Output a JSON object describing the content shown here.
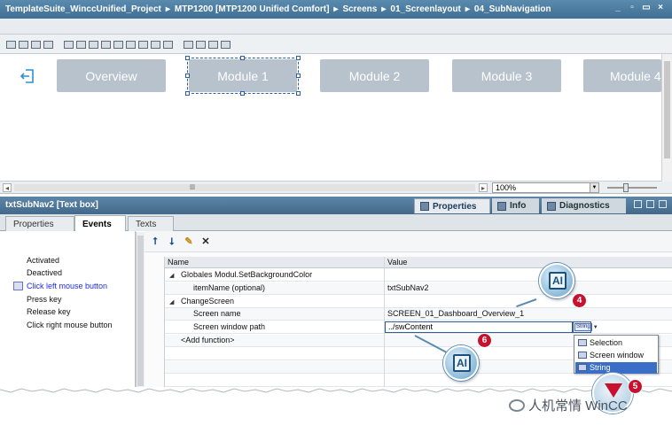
{
  "breadcrumb": {
    "items": [
      "TemplateSuite_WinccUnified_Project",
      "MTP1200 [MTP1200 Unified Comfort]",
      "Screens",
      "01_Screenlayout",
      "04_SubNavigation"
    ],
    "separator": "▸"
  },
  "window_controls": [
    "minimize-icon",
    "restore-icon",
    "maximize-icon",
    "close-icon"
  ],
  "nav": {
    "exit_icon": "logout-icon",
    "buttons": [
      "Overview",
      "Module 1",
      "Module 2",
      "Module 3",
      "Module 4"
    ],
    "selected": "Module 1",
    "button_color": "#b7c2cc"
  },
  "zoom": {
    "value": "100%"
  },
  "properties_panel": {
    "title": "txtSubNav2 [Text box]",
    "tabs": [
      "Properties",
      "Info",
      "Diagnostics"
    ],
    "active_tab": "Properties",
    "subtabs": [
      "Properties",
      "Events",
      "Texts"
    ],
    "active_subtab": "Events"
  },
  "events": {
    "items": [
      "Activated",
      "Deactived",
      "Click left mouse button",
      "Press key",
      "Release key",
      "Click right mouse button"
    ],
    "active": "Click left mouse button"
  },
  "editor": {
    "toolbar": [
      "move-up-icon",
      "move-down-icon",
      "script-icon",
      "delete-icon"
    ],
    "columns": [
      "Name",
      "Value"
    ],
    "rows": [
      {
        "name": "Globales Modul.SetBackgroundColor",
        "value": "",
        "level": 0,
        "expanded": true
      },
      {
        "name": "itemName (optional)",
        "value": "txtSubNav2",
        "level": 1
      },
      {
        "name": "ChangeScreen",
        "value": "",
        "level": 0,
        "expanded": true
      },
      {
        "name": "Screen name",
        "value": "SCREEN_01_Dashboard_Overview_1",
        "level": 1
      },
      {
        "name": "Screen window path",
        "value": "../swContent",
        "level": 1
      },
      {
        "name": "<Add function>",
        "value": "",
        "level": 0
      }
    ],
    "type_button_label": "String"
  },
  "dropdown": {
    "items": [
      "Selection",
      "Screen window",
      "String"
    ],
    "selected": "String"
  },
  "callouts": {
    "ai_label": "AI",
    "badges": [
      "4",
      "5",
      "6"
    ]
  },
  "watermark": {
    "text": "人机常情 WinCC"
  },
  "colors": {
    "title_bar": "#4b7a9e",
    "accent": "#3b6ec6",
    "badge": "#c8112e"
  }
}
